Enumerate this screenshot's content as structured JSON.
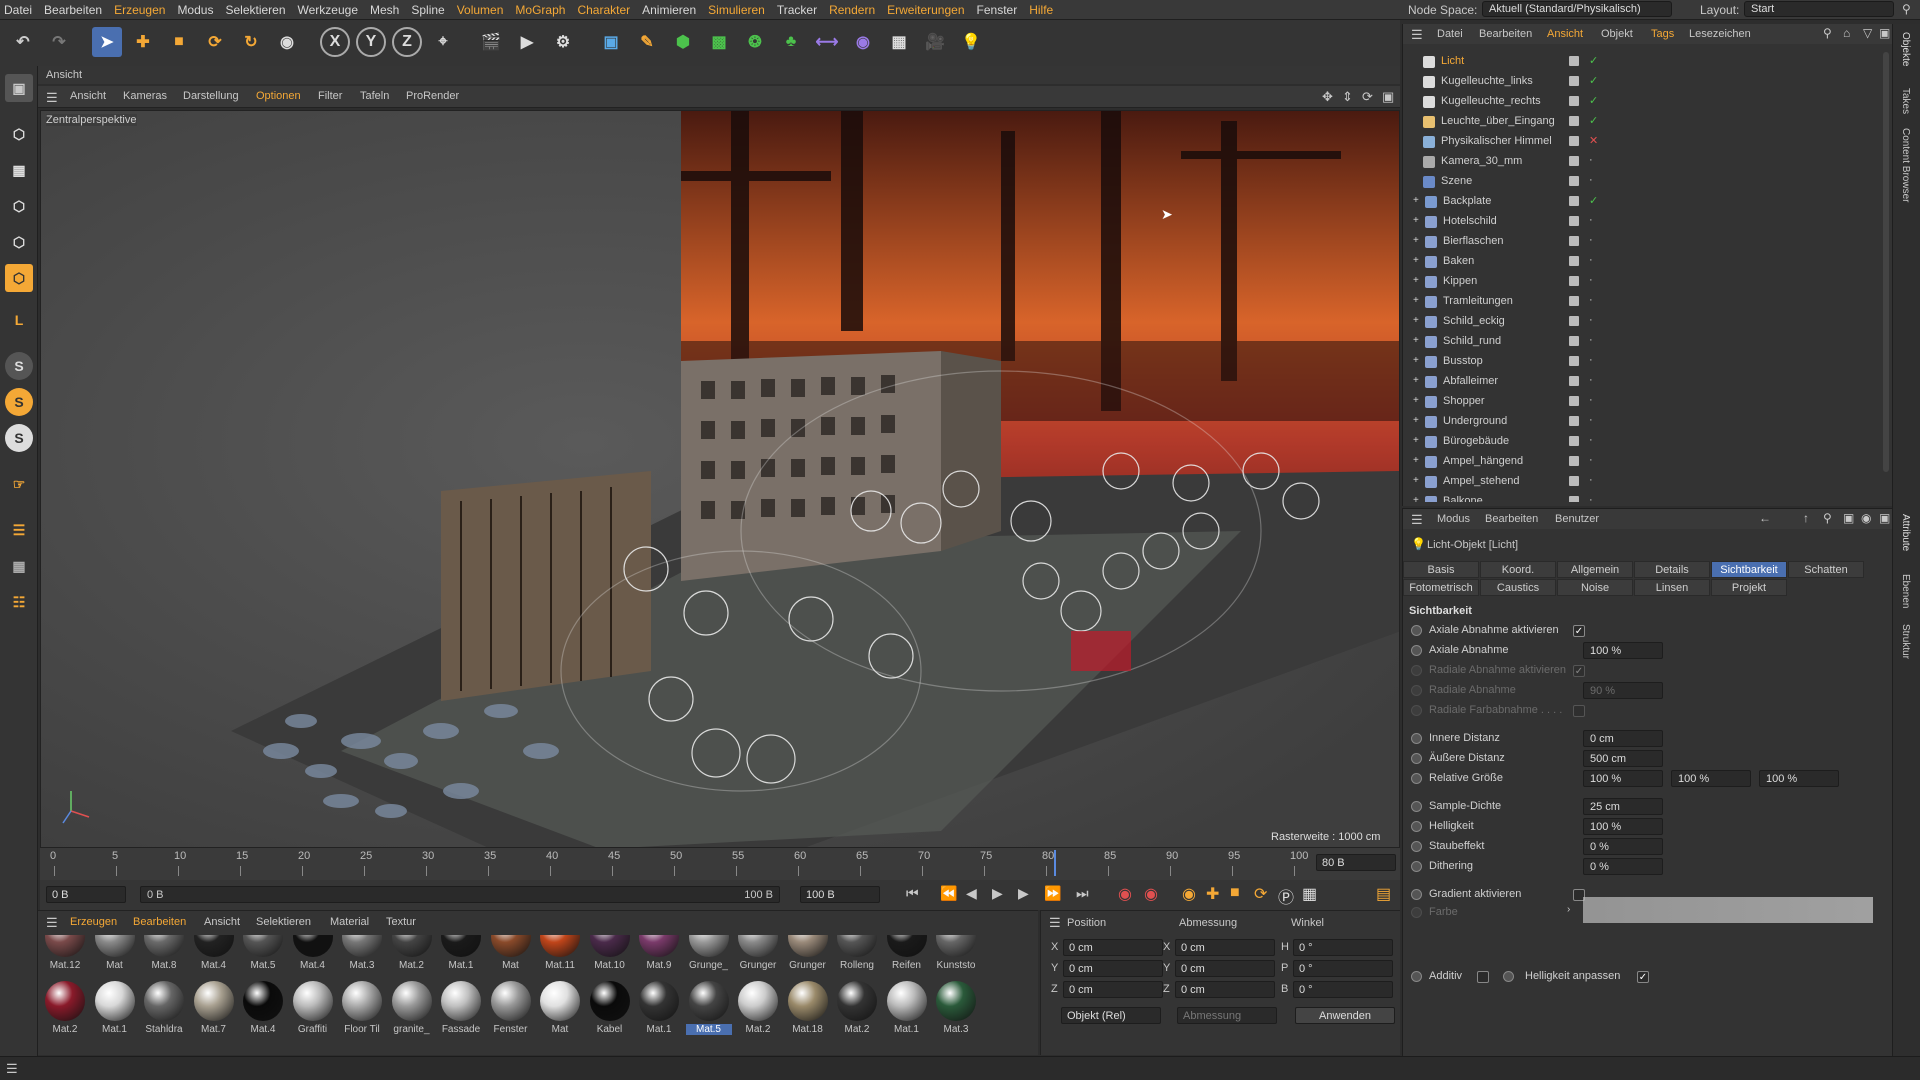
{
  "menubar": {
    "items": [
      "Datei",
      "Bearbeiten",
      "Erzeugen",
      "Modus",
      "Selektieren",
      "Werkzeuge",
      "Mesh",
      "Spline",
      "Volumen",
      "MoGraph",
      "Charakter",
      "Animieren",
      "Simulieren",
      "Tracker",
      "Rendern",
      "Erweiterungen",
      "Fenster",
      "Hilfe"
    ],
    "node_space_label": "Node Space:",
    "node_space_value": "Aktuell (Standard/Physikalisch)",
    "layout_label": "Layout:",
    "layout_value": "Start"
  },
  "viewport": {
    "panel_title": "Ansicht",
    "menu": [
      "Ansicht",
      "Kameras",
      "Darstellung",
      "Optionen",
      "Filter",
      "Tafeln",
      "ProRender"
    ],
    "camera_label": "Zentralperspektive",
    "grid_label": "Rasterweite : 1000 cm"
  },
  "timeline": {
    "ticks": [
      "0",
      "5",
      "10",
      "15",
      "20",
      "25",
      "30",
      "35",
      "40",
      "45",
      "50",
      "55",
      "60",
      "65",
      "70",
      "75",
      "80",
      "85",
      "90",
      "95",
      "100"
    ],
    "current_frame": "80 B",
    "start_field": "0 B",
    "range_start": "0 B",
    "range_end": "100 B",
    "end_field": "100 B"
  },
  "material_panel": {
    "menu": [
      "Erzeugen",
      "Bearbeiten",
      "Ansicht",
      "Selektieren",
      "Material",
      "Textur"
    ],
    "row1": [
      {
        "name": "Mat.12",
        "color": "#7a4a4a"
      },
      {
        "name": "Mat",
        "color": "#8a8a8a"
      },
      {
        "name": "Mat.8",
        "color": "#6a6a6a"
      },
      {
        "name": "Mat.4",
        "color": "#222"
      },
      {
        "name": "Mat.5",
        "color": "#555"
      },
      {
        "name": "Mat.4",
        "color": "#111"
      },
      {
        "name": "Mat.3",
        "color": "#777"
      },
      {
        "name": "Mat.2",
        "color": "#444"
      },
      {
        "name": "Mat.1",
        "color": "#1a1a1a"
      },
      {
        "name": "Mat",
        "color": "#8a4a2a"
      },
      {
        "name": "Mat.11",
        "color": "#c0451a"
      },
      {
        "name": "Mat.10",
        "color": "#4a2a4a"
      },
      {
        "name": "Mat.9",
        "color": "#7a3a6a"
      },
      {
        "name": "Grunge_",
        "color": "#999"
      },
      {
        "name": "Grunger",
        "color": "#8a8a8a"
      },
      {
        "name": "Grunger",
        "color": "#9a8a7a"
      },
      {
        "name": "Rolleng",
        "color": "#555"
      },
      {
        "name": "Reifen",
        "color": "#1a1a1a"
      },
      {
        "name": "Kunststo",
        "color": "#666"
      }
    ],
    "row2": [
      {
        "name": "Mat.2",
        "color": "#8a1a2a"
      },
      {
        "name": "Mat.1",
        "color": "#d8d8d8"
      },
      {
        "name": "Stahldra",
        "color": "#666"
      },
      {
        "name": "Mat.7",
        "color": "#a8a090"
      },
      {
        "name": "Mat.4",
        "color": "#0a0a0a"
      },
      {
        "name": "Graffiti",
        "color": "#bbb"
      },
      {
        "name": "Floor Til",
        "color": "#aaa"
      },
      {
        "name": "granite_",
        "color": "#9a9a9a"
      },
      {
        "name": "Fassade",
        "color": "#c0c0c0"
      },
      {
        "name": "Fenster",
        "color": "#999"
      },
      {
        "name": "Mat",
        "color": "#e0e0e0"
      },
      {
        "name": "Kabel",
        "color": "#0a0a0a"
      },
      {
        "name": "Mat.1",
        "color": "#333"
      },
      {
        "name": "Mat.5",
        "color": "#444"
      },
      {
        "name": "Mat.2",
        "color": "#ccc"
      },
      {
        "name": "Mat.18",
        "color": "#9a8a6a"
      },
      {
        "name": "Mat.2",
        "color": "#333"
      },
      {
        "name": "Mat.1",
        "color": "#bbb"
      },
      {
        "name": "Mat.3",
        "color": "#2a5a3a"
      }
    ],
    "selected": "Mat.5"
  },
  "coord_panel": {
    "headers": [
      "Position",
      "Abmessung",
      "Winkel"
    ],
    "rows": [
      {
        "axis": "X",
        "pos": "0 cm",
        "size_axis": "X",
        "size": "0 cm",
        "ang_axis": "H",
        "angle": "0 °"
      },
      {
        "axis": "Y",
        "pos": "0 cm",
        "size_axis": "Y",
        "size": "0 cm",
        "ang_axis": "P",
        "angle": "0 °"
      },
      {
        "axis": "Z",
        "pos": "0 cm",
        "size_axis": "Z",
        "size": "0 cm",
        "ang_axis": "B",
        "angle": "0 °"
      }
    ],
    "mode": "Objekt (Rel)",
    "mode2": "Abmessung",
    "apply": "Anwenden"
  },
  "object_manager": {
    "menu": [
      "Datei",
      "Bearbeiten",
      "Ansicht",
      "Objekt",
      "Tags",
      "Lesezeichen"
    ],
    "objects": [
      {
        "name": "Licht",
        "indent": 0,
        "color": "#dcdcdc",
        "selected": true
      },
      {
        "name": "Kugelleuchte_links",
        "indent": 0,
        "color": "#dcdcdc"
      },
      {
        "name": "Kugelleuchte_rechts",
        "indent": 0,
        "color": "#dcdcdc"
      },
      {
        "name": "Leuchte_über_Eingang",
        "indent": 0,
        "color": "#e8c070"
      },
      {
        "name": "Physikalischer Himmel",
        "indent": 0,
        "color": "#8ab0d8"
      },
      {
        "name": "Kamera_30_mm",
        "indent": 0,
        "color": "#aaa"
      },
      {
        "name": "Szene",
        "indent": 0,
        "color": "#6a8ac8"
      },
      {
        "name": "Backplate",
        "indent": 1,
        "color": "#7a9ad0"
      },
      {
        "name": "Hotelschild",
        "indent": 1,
        "color": "#8aa0d0"
      },
      {
        "name": "Bierflaschen",
        "indent": 1,
        "color": "#8aa0d0"
      },
      {
        "name": "Baken",
        "indent": 1,
        "color": "#8aa0d0"
      },
      {
        "name": "Kippen",
        "indent": 1,
        "color": "#8aa0d0"
      },
      {
        "name": "Tramleitungen",
        "indent": 1,
        "color": "#8aa0d0"
      },
      {
        "name": "Schild_eckig",
        "indent": 1,
        "color": "#8aa0d0"
      },
      {
        "name": "Schild_rund",
        "indent": 1,
        "color": "#8aa0d0"
      },
      {
        "name": "Busstop",
        "indent": 1,
        "color": "#8aa0d0"
      },
      {
        "name": "Abfalleimer",
        "indent": 1,
        "color": "#8aa0d0"
      },
      {
        "name": "Shopper",
        "indent": 1,
        "color": "#8aa0d0"
      },
      {
        "name": "Underground",
        "indent": 1,
        "color": "#8aa0d0"
      },
      {
        "name": "Bürogebäude",
        "indent": 1,
        "color": "#8aa0d0"
      },
      {
        "name": "Ampel_hängend",
        "indent": 1,
        "color": "#8aa0d0"
      },
      {
        "name": "Ampel_stehend",
        "indent": 1,
        "color": "#8aa0d0"
      },
      {
        "name": "Balkone",
        "indent": 1,
        "color": "#8aa0d0"
      }
    ]
  },
  "attribute_manager": {
    "menu": [
      "Modus",
      "Bearbeiten",
      "Benutzer"
    ],
    "object_title": "Licht-Objekt [Licht]",
    "tabs_row1": [
      "Basis",
      "Koord.",
      "Allgemein",
      "Details",
      "Sichtbarkeit",
      "Schatten"
    ],
    "tabs_row2": [
      "Fotometrisch",
      "Caustics",
      "Noise",
      "Linsen",
      "Projekt"
    ],
    "active_tab": "Sichtbarkeit",
    "section": "Sichtbarkeit",
    "rows": [
      {
        "label": "Axiale Abnahme aktivieren",
        "type": "check",
        "checked": true,
        "dim": false
      },
      {
        "label": "Axiale Abnahme",
        "value": "100 %",
        "dim": false
      },
      {
        "label": "Radiale Abnahme aktivieren",
        "type": "check",
        "checked": true,
        "dim": true
      },
      {
        "label": "Radiale Abnahme",
        "value": "90 %",
        "dim": true
      },
      {
        "label": "Radiale Farbabnahme . . . .",
        "type": "check",
        "checked": false,
        "dim": true
      },
      {
        "label": "Innere Distanz",
        "value": "0 cm",
        "dim": false
      },
      {
        "label": "Äußere Distanz",
        "value": "500 cm",
        "dim": false
      },
      {
        "label": "Relative Größe",
        "value": "100 %",
        "value2": "100 %",
        "value3": "100 %",
        "dim": false
      },
      {
        "label": "Sample-Dichte",
        "value": "25 cm",
        "dim": false
      },
      {
        "label": "Helligkeit",
        "value": "100 %",
        "dim": false
      },
      {
        "label": "Staubeffekt",
        "value": "0 %",
        "dim": false
      },
      {
        "label": "Dithering",
        "value": "0 %",
        "dim": false
      },
      {
        "label": "Gradient aktivieren",
        "type": "check",
        "checked": false,
        "dim": false
      },
      {
        "label": "Farbe",
        "type": "gradient",
        "dim": true
      }
    ],
    "additiv_label": "Additiv",
    "helligkeit_anpassen_label": "Helligkeit anpassen"
  },
  "side_tabs": [
    "Objekte",
    "Takes",
    "Content Browser",
    "Attribute",
    "Ebenen",
    "Struktur"
  ],
  "colors": {
    "accent": "#4a6fb0",
    "menu_highlight": "#f4a836",
    "check_green": "#4cc24c"
  }
}
